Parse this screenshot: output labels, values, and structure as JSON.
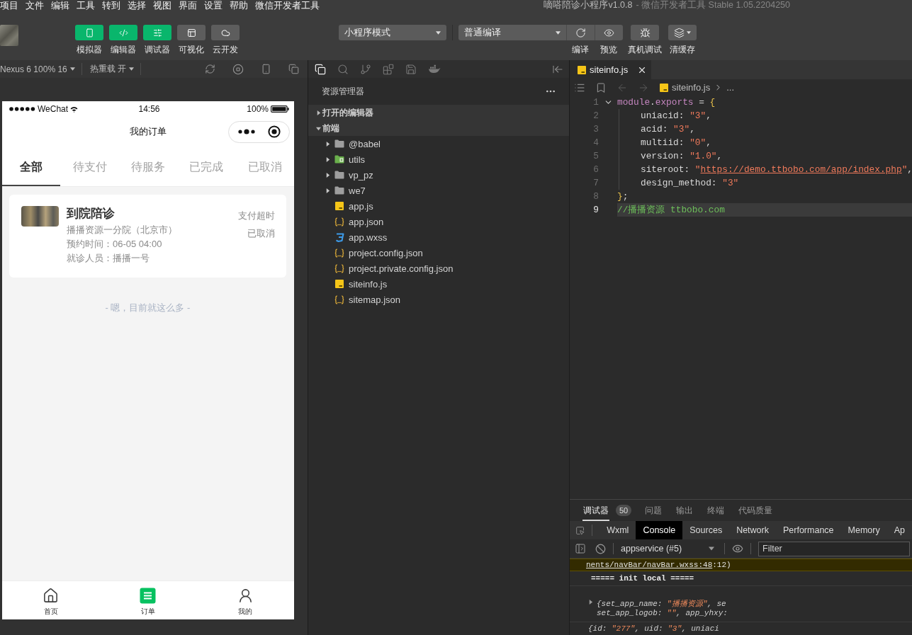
{
  "menu_bar": {
    "items": [
      "项目",
      "文件",
      "编辑",
      "工具",
      "转到",
      "选择",
      "视图",
      "界面",
      "设置",
      "帮助",
      "微信开发者工具"
    ],
    "title": "嘀嗒陪诊小程序v1.0.8",
    "subtitle": "- 微信开发者工具 Stable 1.05.2204250"
  },
  "toolbar": {
    "mode_buttons": [
      {
        "label": "模拟器",
        "on": true
      },
      {
        "label": "编辑器",
        "on": true
      },
      {
        "label": "调试器",
        "on": true
      },
      {
        "label": "可视化",
        "on": false
      },
      {
        "label": "云开发",
        "on": false
      }
    ],
    "mode_select": "小程序模式",
    "compile_select": "普通编译",
    "actions": [
      {
        "label": "编译",
        "kind": "attached"
      },
      {
        "label": "预览",
        "kind": "attached"
      },
      {
        "label": "真机调试",
        "kind": "button"
      },
      {
        "label": "清缓存",
        "kind": "menu"
      }
    ]
  },
  "simulator": {
    "device": "Nexus 6 100% 16",
    "hot_reload": "热重载 开",
    "phone": {
      "status_bar": {
        "carrier": "WeChat",
        "time": "14:56",
        "battery": "100%"
      },
      "nav_title": "我的订单",
      "tabs": [
        {
          "label": "全部",
          "selected": true
        },
        {
          "label": "待支付",
          "selected": false
        },
        {
          "label": "待服务",
          "selected": false
        },
        {
          "label": "已完成",
          "selected": false
        },
        {
          "label": "已取消",
          "selected": false
        }
      ],
      "orders": [
        {
          "title": "到院陪诊",
          "hospital": "播播资源一分院（北京市）",
          "time": "预约时间：06-05 04:00",
          "patient": "就诊人员：播播一号",
          "status": "支付超时",
          "state": "已取消"
        }
      ],
      "footer": "- 嗯，目前就这么多 -",
      "tab_bar": [
        {
          "label": "首页",
          "selected": false
        },
        {
          "label": "订单",
          "selected": true
        },
        {
          "label": "我的",
          "selected": false
        }
      ]
    }
  },
  "explorer": {
    "title": "资源管理器",
    "sections": [
      {
        "label": "打开的编辑器",
        "expanded": false
      },
      {
        "label": "前端",
        "expanded": true,
        "children": [
          {
            "label": "@babel",
            "kind": "folder",
            "expanded": false
          },
          {
            "label": "utils",
            "kind": "module",
            "expanded": false
          },
          {
            "label": "vp_pz",
            "kind": "folder",
            "expanded": false
          },
          {
            "label": "we7",
            "kind": "folder",
            "expanded": false
          },
          {
            "label": "app.js",
            "kind": "js"
          },
          {
            "label": "app.json",
            "kind": "json"
          },
          {
            "label": "app.wxss",
            "kind": "wxss"
          },
          {
            "label": "project.config.json",
            "kind": "json"
          },
          {
            "label": "project.private.config.json",
            "kind": "json"
          },
          {
            "label": "siteinfo.js",
            "kind": "js"
          },
          {
            "label": "sitemap.json",
            "kind": "json"
          }
        ]
      }
    ]
  },
  "editor": {
    "tabs": [
      {
        "label": "siteinfo.js",
        "kind": "js",
        "selected": true
      }
    ],
    "breadcrumb": [
      {
        "label": "siteinfo.js",
        "kind": "js"
      },
      {
        "label": "...",
        "kind": "more"
      }
    ],
    "code": [
      {
        "number": "1",
        "folded": false,
        "indented": false,
        "current": false,
        "tokens": [
          {
            "kind": "keyword",
            "text": "module"
          },
          {
            "kind": "punct",
            "text": "."
          },
          {
            "kind": "keyword",
            "text": "exports"
          },
          {
            "kind": "punct",
            "text": " = "
          },
          {
            "kind": "brace",
            "text": "{"
          }
        ]
      },
      {
        "number": "2",
        "indented": true,
        "current": false,
        "tokens": [
          {
            "kind": "key",
            "text": "uniacid"
          },
          {
            "kind": "punct",
            "text": ": "
          },
          {
            "kind": "string",
            "text": "\"3\""
          },
          {
            "kind": "punct",
            "text": ","
          }
        ]
      },
      {
        "number": "3",
        "indented": true,
        "current": false,
        "tokens": [
          {
            "kind": "key",
            "text": "acid"
          },
          {
            "kind": "punct",
            "text": ": "
          },
          {
            "kind": "string",
            "text": "\"3\""
          },
          {
            "kind": "punct",
            "text": ","
          }
        ]
      },
      {
        "number": "4",
        "indented": true,
        "current": false,
        "tokens": [
          {
            "kind": "key",
            "text": "multiid"
          },
          {
            "kind": "punct",
            "text": ": "
          },
          {
            "kind": "string",
            "text": "\"0\""
          },
          {
            "kind": "punct",
            "text": ","
          }
        ]
      },
      {
        "number": "5",
        "indented": true,
        "current": false,
        "tokens": [
          {
            "kind": "key",
            "text": "version"
          },
          {
            "kind": "punct",
            "text": ": "
          },
          {
            "kind": "string",
            "text": "\"1.0\""
          },
          {
            "kind": "punct",
            "text": ","
          }
        ]
      },
      {
        "number": "6",
        "indented": true,
        "current": false,
        "tokens": [
          {
            "kind": "key",
            "text": "siteroot"
          },
          {
            "kind": "punct",
            "text": ": "
          },
          {
            "kind": "string",
            "text": "\""
          },
          {
            "kind": "link",
            "text": "https://demo.ttbobo.com/app/index.php"
          },
          {
            "kind": "string",
            "text": "\""
          },
          {
            "kind": "punct",
            "text": ","
          }
        ]
      },
      {
        "number": "7",
        "indented": true,
        "current": false,
        "tokens": [
          {
            "kind": "key",
            "text": "design_method"
          },
          {
            "kind": "punct",
            "text": ": "
          },
          {
            "kind": "string",
            "text": "\"3\""
          }
        ]
      },
      {
        "number": "8",
        "indented": false,
        "current": false,
        "tokens": [
          {
            "kind": "brace",
            "text": "}"
          },
          {
            "kind": "punct",
            "text": ";"
          }
        ]
      },
      {
        "number": "9",
        "indented": false,
        "current": true,
        "tokens": [
          {
            "kind": "comment",
            "text": "//播播资源 ttbobo.com"
          }
        ]
      }
    ]
  },
  "debugger": {
    "tabs": [
      {
        "label": "调试器",
        "badge": "50",
        "selected": true
      },
      {
        "label": "问题",
        "selected": false
      },
      {
        "label": "输出",
        "selected": false
      },
      {
        "label": "终端",
        "selected": false
      },
      {
        "label": "代码质量",
        "selected": false
      }
    ],
    "devtools_tabs": [
      {
        "label": "Wxml",
        "selected": false
      },
      {
        "label": "Console",
        "selected": true
      },
      {
        "label": "Sources",
        "selected": false
      },
      {
        "label": "Network",
        "selected": false
      },
      {
        "label": "Performance",
        "selected": false
      },
      {
        "label": "Memory",
        "selected": false
      },
      {
        "label": "Ap",
        "selected": false
      }
    ],
    "context": "appservice (#5)",
    "filter": {
      "placeholder": "Filter"
    },
    "console": [
      {
        "kind": "warning",
        "link": "nents/navBar/navBar.wxss:48",
        "text": ":12)"
      },
      {
        "kind": "log",
        "text": "===== init local ====="
      },
      {
        "kind": "object",
        "expanded": false,
        "lines": [
          [
            {
              "kind": "plain",
              "text": "{set_app_name: "
            },
            {
              "kind": "string",
              "text": "\"播播资源\""
            },
            {
              "kind": "plain",
              "text": ", se"
            }
          ],
          [
            {
              "kind": "plain",
              "text": "set_app_logob: "
            },
            {
              "kind": "string",
              "text": "\"\""
            },
            {
              "kind": "plain",
              "text": ", app_yhxy:"
            }
          ]
        ]
      },
      {
        "kind": "fragment",
        "lines": [
          [
            {
              "kind": "plain",
              "text": "{id: "
            },
            {
              "kind": "string",
              "text": "\"277\""
            },
            {
              "kind": "plain",
              "text": ", uid: "
            },
            {
              "kind": "string",
              "text": "\"3\""
            },
            {
              "kind": "plain",
              "text": ", uniaci"
            }
          ]
        ]
      }
    ]
  }
}
